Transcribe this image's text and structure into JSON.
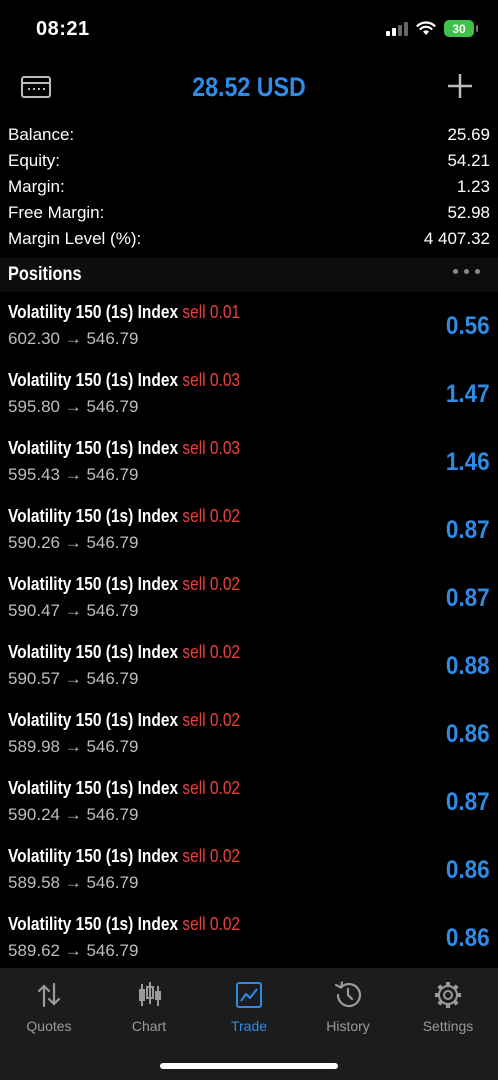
{
  "status_bar": {
    "time": "08:21",
    "battery": "30"
  },
  "header": {
    "balance_title": "28.52 USD"
  },
  "summary": [
    {
      "label": "Balance:",
      "value": "25.69"
    },
    {
      "label": "Equity:",
      "value": "54.21"
    },
    {
      "label": "Margin:",
      "value": "1.23"
    },
    {
      "label": "Free Margin:",
      "value": "52.98"
    },
    {
      "label": "Margin Level (%):",
      "value": "4 407.32"
    }
  ],
  "positions": {
    "title": "Positions",
    "items": [
      {
        "symbol": "Volatility 150 (1s) Index",
        "side": "sell 0.01",
        "prices": "602.30 → 546.79",
        "profit": "0.56"
      },
      {
        "symbol": "Volatility 150 (1s) Index",
        "side": "sell 0.03",
        "prices": "595.80 → 546.79",
        "profit": "1.47"
      },
      {
        "symbol": "Volatility 150 (1s) Index",
        "side": "sell 0.03",
        "prices": "595.43 → 546.79",
        "profit": "1.46"
      },
      {
        "symbol": "Volatility 150 (1s) Index",
        "side": "sell 0.02",
        "prices": "590.26 → 546.79",
        "profit": "0.87"
      },
      {
        "symbol": "Volatility 150 (1s) Index",
        "side": "sell 0.02",
        "prices": "590.47 → 546.79",
        "profit": "0.87"
      },
      {
        "symbol": "Volatility 150 (1s) Index",
        "side": "sell 0.02",
        "prices": "590.57 → 546.79",
        "profit": "0.88"
      },
      {
        "symbol": "Volatility 150 (1s) Index",
        "side": "sell 0.02",
        "prices": "589.98 → 546.79",
        "profit": "0.86"
      },
      {
        "symbol": "Volatility 150 (1s) Index",
        "side": "sell 0.02",
        "prices": "590.24 → 546.79",
        "profit": "0.87"
      },
      {
        "symbol": "Volatility 150 (1s) Index",
        "side": "sell 0.02",
        "prices": "589.58 → 546.79",
        "profit": "0.86"
      },
      {
        "symbol": "Volatility 150 (1s) Index",
        "side": "sell 0.02",
        "prices": "589.62 → 546.79",
        "profit": "0.86"
      }
    ]
  },
  "tabs": [
    {
      "label": "Quotes",
      "icon": "quotes-icon",
      "active": false
    },
    {
      "label": "Chart",
      "icon": "chart-icon",
      "active": false
    },
    {
      "label": "Trade",
      "icon": "trade-icon",
      "active": true
    },
    {
      "label": "History",
      "icon": "history-icon",
      "active": false
    },
    {
      "label": "Settings",
      "icon": "settings-icon",
      "active": false
    }
  ],
  "colors": {
    "accent": "#2f8be6",
    "sell": "#e8423c",
    "background": "#000000",
    "tabbar": "#1c1c1e"
  }
}
